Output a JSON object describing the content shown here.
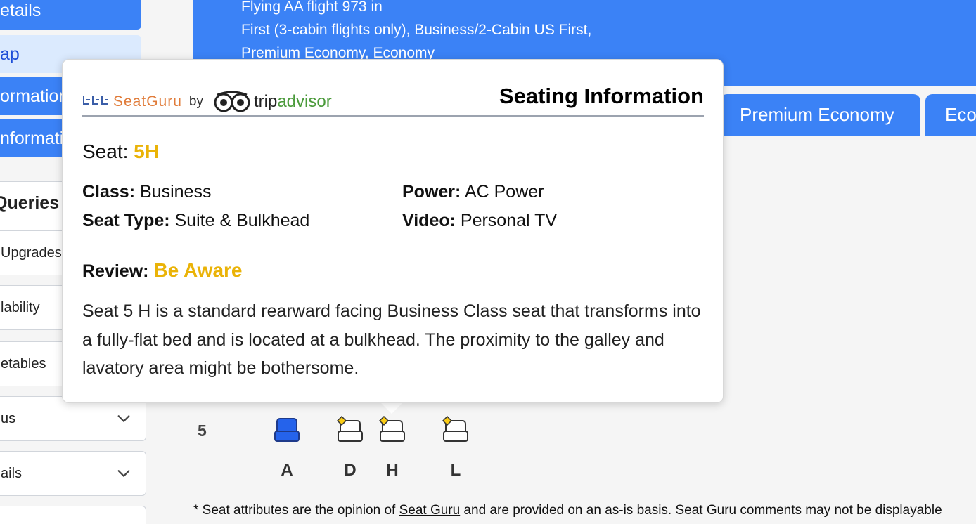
{
  "sidebar": {
    "items": [
      {
        "label": "etails",
        "style": "blue"
      },
      {
        "label": "ap",
        "style": "light"
      },
      {
        "label": "ormation",
        "style": "blue"
      },
      {
        "label": "nformation",
        "style": "blue"
      }
    ],
    "queries_title": "Queries",
    "query_items": [
      {
        "label": "Upgrades"
      },
      {
        "label": "lability"
      },
      {
        "label": "etables"
      },
      {
        "label": "us"
      },
      {
        "label": "ails"
      }
    ]
  },
  "header": {
    "lines": [
      "Flying AA flight 973 in",
      "First (3-cabin flights only), Business/2-Cabin US First,",
      "Premium Economy, Economy"
    ]
  },
  "tabs": [
    {
      "label": "Premium Economy"
    },
    {
      "label": "Economy"
    }
  ],
  "seat_map": {
    "row_number": "5",
    "columns": [
      "A",
      "D",
      "H",
      "L"
    ]
  },
  "footnote": {
    "prefix": "* Seat attributes are the opinion of ",
    "link": "Seat Guru",
    "suffix": " and are provided on an as-is basis. Seat Guru comments may not be displayable"
  },
  "popover": {
    "brand_seatguru": "SeatGuru",
    "brand_by": "by",
    "brand_trip": "trip",
    "brand_advisor": "advisor",
    "title": "Seating Information",
    "seat_label": "Seat:",
    "seat_value": "5H",
    "class_label": "Class:",
    "class_value": "Business",
    "seat_type_label": "Seat Type:",
    "seat_type_value": "Suite & Bulkhead",
    "power_label": "Power:",
    "power_value": "AC Power",
    "video_label": "Video:",
    "video_value": "Personal TV",
    "review_label": "Review:",
    "review_value": "Be Aware",
    "description": "Seat 5 H is a standard rearward facing Business Class seat that transforms into a fully-flat bed and is located at a bulkhead. The proximity to the galley and lavatory area might be bothersome."
  },
  "colors": {
    "accent_blue": "#3b82f6",
    "gold": "#eab308",
    "seat_selected": "#2563eb",
    "seat_flag": "#facc15"
  }
}
